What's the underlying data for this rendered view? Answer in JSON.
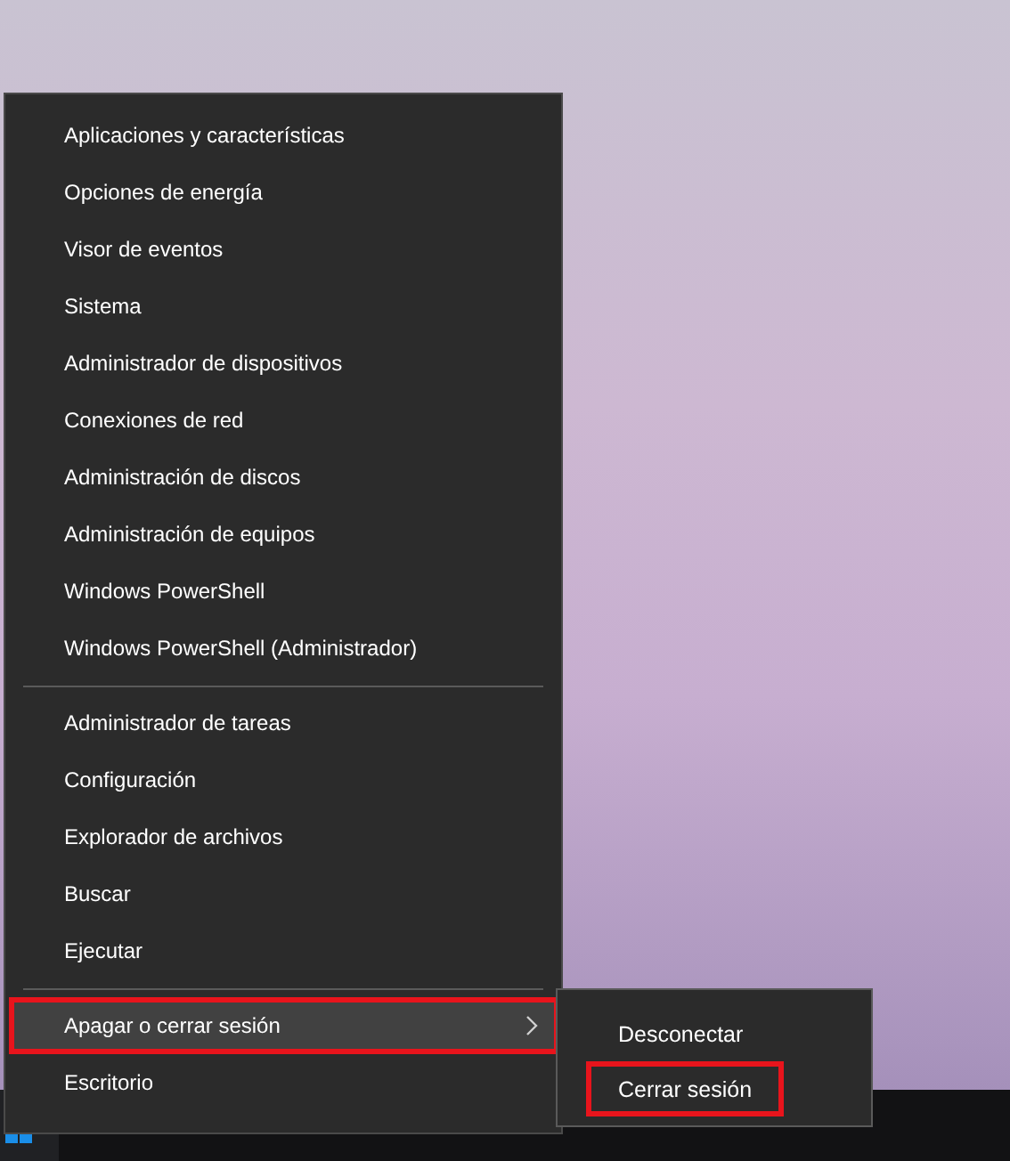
{
  "menu": {
    "groups": [
      {
        "items": [
          {
            "label": "Aplicaciones y características",
            "selected": false,
            "highlighted": false,
            "has_submenu": false
          },
          {
            "label": "Opciones de energía",
            "selected": false,
            "highlighted": false,
            "has_submenu": false
          },
          {
            "label": "Visor de eventos",
            "selected": false,
            "highlighted": false,
            "has_submenu": false
          },
          {
            "label": "Sistema",
            "selected": false,
            "highlighted": false,
            "has_submenu": false
          },
          {
            "label": "Administrador de dispositivos",
            "selected": false,
            "highlighted": false,
            "has_submenu": false
          },
          {
            "label": "Conexiones de red",
            "selected": false,
            "highlighted": false,
            "has_submenu": false
          },
          {
            "label": "Administración de discos",
            "selected": false,
            "highlighted": false,
            "has_submenu": false
          },
          {
            "label": "Administración de equipos",
            "selected": false,
            "highlighted": false,
            "has_submenu": false
          },
          {
            "label": "Windows PowerShell",
            "selected": false,
            "highlighted": false,
            "has_submenu": false
          },
          {
            "label": "Windows PowerShell (Administrador)",
            "selected": false,
            "highlighted": false,
            "has_submenu": false
          }
        ]
      },
      {
        "items": [
          {
            "label": "Administrador de tareas",
            "selected": false,
            "highlighted": false,
            "has_submenu": false
          },
          {
            "label": "Configuración",
            "selected": false,
            "highlighted": false,
            "has_submenu": false
          },
          {
            "label": "Explorador de archivos",
            "selected": false,
            "highlighted": false,
            "has_submenu": false
          },
          {
            "label": "Buscar",
            "selected": false,
            "highlighted": false,
            "has_submenu": false
          },
          {
            "label": "Ejecutar",
            "selected": false,
            "highlighted": false,
            "has_submenu": false
          }
        ]
      },
      {
        "items": [
          {
            "label": "Apagar o cerrar sesión",
            "selected": true,
            "highlighted": true,
            "has_submenu": true
          },
          {
            "label": "Escritorio",
            "selected": false,
            "highlighted": false,
            "has_submenu": false
          }
        ]
      }
    ]
  },
  "submenu": {
    "items": [
      {
        "label": "Desconectar",
        "highlighted": false
      },
      {
        "label": "Cerrar sesión",
        "highlighted": true
      }
    ]
  }
}
